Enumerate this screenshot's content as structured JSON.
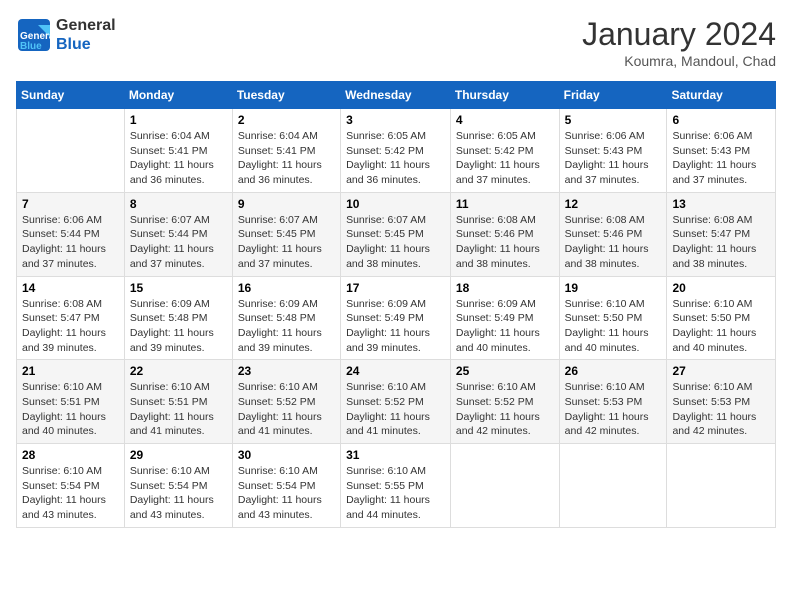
{
  "header": {
    "logo_line1": "General",
    "logo_line2": "Blue",
    "month_title": "January 2024",
    "location": "Koumra, Mandoul, Chad"
  },
  "days_of_week": [
    "Sunday",
    "Monday",
    "Tuesday",
    "Wednesday",
    "Thursday",
    "Friday",
    "Saturday"
  ],
  "weeks": [
    [
      {
        "day": "",
        "info": ""
      },
      {
        "day": "1",
        "info": "Sunrise: 6:04 AM\nSunset: 5:41 PM\nDaylight: 11 hours\nand 36 minutes."
      },
      {
        "day": "2",
        "info": "Sunrise: 6:04 AM\nSunset: 5:41 PM\nDaylight: 11 hours\nand 36 minutes."
      },
      {
        "day": "3",
        "info": "Sunrise: 6:05 AM\nSunset: 5:42 PM\nDaylight: 11 hours\nand 36 minutes."
      },
      {
        "day": "4",
        "info": "Sunrise: 6:05 AM\nSunset: 5:42 PM\nDaylight: 11 hours\nand 37 minutes."
      },
      {
        "day": "5",
        "info": "Sunrise: 6:06 AM\nSunset: 5:43 PM\nDaylight: 11 hours\nand 37 minutes."
      },
      {
        "day": "6",
        "info": "Sunrise: 6:06 AM\nSunset: 5:43 PM\nDaylight: 11 hours\nand 37 minutes."
      }
    ],
    [
      {
        "day": "7",
        "info": "Sunrise: 6:06 AM\nSunset: 5:44 PM\nDaylight: 11 hours\nand 37 minutes."
      },
      {
        "day": "8",
        "info": "Sunrise: 6:07 AM\nSunset: 5:44 PM\nDaylight: 11 hours\nand 37 minutes."
      },
      {
        "day": "9",
        "info": "Sunrise: 6:07 AM\nSunset: 5:45 PM\nDaylight: 11 hours\nand 37 minutes."
      },
      {
        "day": "10",
        "info": "Sunrise: 6:07 AM\nSunset: 5:45 PM\nDaylight: 11 hours\nand 38 minutes."
      },
      {
        "day": "11",
        "info": "Sunrise: 6:08 AM\nSunset: 5:46 PM\nDaylight: 11 hours\nand 38 minutes."
      },
      {
        "day": "12",
        "info": "Sunrise: 6:08 AM\nSunset: 5:46 PM\nDaylight: 11 hours\nand 38 minutes."
      },
      {
        "day": "13",
        "info": "Sunrise: 6:08 AM\nSunset: 5:47 PM\nDaylight: 11 hours\nand 38 minutes."
      }
    ],
    [
      {
        "day": "14",
        "info": "Sunrise: 6:08 AM\nSunset: 5:47 PM\nDaylight: 11 hours\nand 39 minutes."
      },
      {
        "day": "15",
        "info": "Sunrise: 6:09 AM\nSunset: 5:48 PM\nDaylight: 11 hours\nand 39 minutes."
      },
      {
        "day": "16",
        "info": "Sunrise: 6:09 AM\nSunset: 5:48 PM\nDaylight: 11 hours\nand 39 minutes."
      },
      {
        "day": "17",
        "info": "Sunrise: 6:09 AM\nSunset: 5:49 PM\nDaylight: 11 hours\nand 39 minutes."
      },
      {
        "day": "18",
        "info": "Sunrise: 6:09 AM\nSunset: 5:49 PM\nDaylight: 11 hours\nand 40 minutes."
      },
      {
        "day": "19",
        "info": "Sunrise: 6:10 AM\nSunset: 5:50 PM\nDaylight: 11 hours\nand 40 minutes."
      },
      {
        "day": "20",
        "info": "Sunrise: 6:10 AM\nSunset: 5:50 PM\nDaylight: 11 hours\nand 40 minutes."
      }
    ],
    [
      {
        "day": "21",
        "info": "Sunrise: 6:10 AM\nSunset: 5:51 PM\nDaylight: 11 hours\nand 40 minutes."
      },
      {
        "day": "22",
        "info": "Sunrise: 6:10 AM\nSunset: 5:51 PM\nDaylight: 11 hours\nand 41 minutes."
      },
      {
        "day": "23",
        "info": "Sunrise: 6:10 AM\nSunset: 5:52 PM\nDaylight: 11 hours\nand 41 minutes."
      },
      {
        "day": "24",
        "info": "Sunrise: 6:10 AM\nSunset: 5:52 PM\nDaylight: 11 hours\nand 41 minutes."
      },
      {
        "day": "25",
        "info": "Sunrise: 6:10 AM\nSunset: 5:52 PM\nDaylight: 11 hours\nand 42 minutes."
      },
      {
        "day": "26",
        "info": "Sunrise: 6:10 AM\nSunset: 5:53 PM\nDaylight: 11 hours\nand 42 minutes."
      },
      {
        "day": "27",
        "info": "Sunrise: 6:10 AM\nSunset: 5:53 PM\nDaylight: 11 hours\nand 42 minutes."
      }
    ],
    [
      {
        "day": "28",
        "info": "Sunrise: 6:10 AM\nSunset: 5:54 PM\nDaylight: 11 hours\nand 43 minutes."
      },
      {
        "day": "29",
        "info": "Sunrise: 6:10 AM\nSunset: 5:54 PM\nDaylight: 11 hours\nand 43 minutes."
      },
      {
        "day": "30",
        "info": "Sunrise: 6:10 AM\nSunset: 5:54 PM\nDaylight: 11 hours\nand 43 minutes."
      },
      {
        "day": "31",
        "info": "Sunrise: 6:10 AM\nSunset: 5:55 PM\nDaylight: 11 hours\nand 44 minutes."
      },
      {
        "day": "",
        "info": ""
      },
      {
        "day": "",
        "info": ""
      },
      {
        "day": "",
        "info": ""
      }
    ]
  ]
}
